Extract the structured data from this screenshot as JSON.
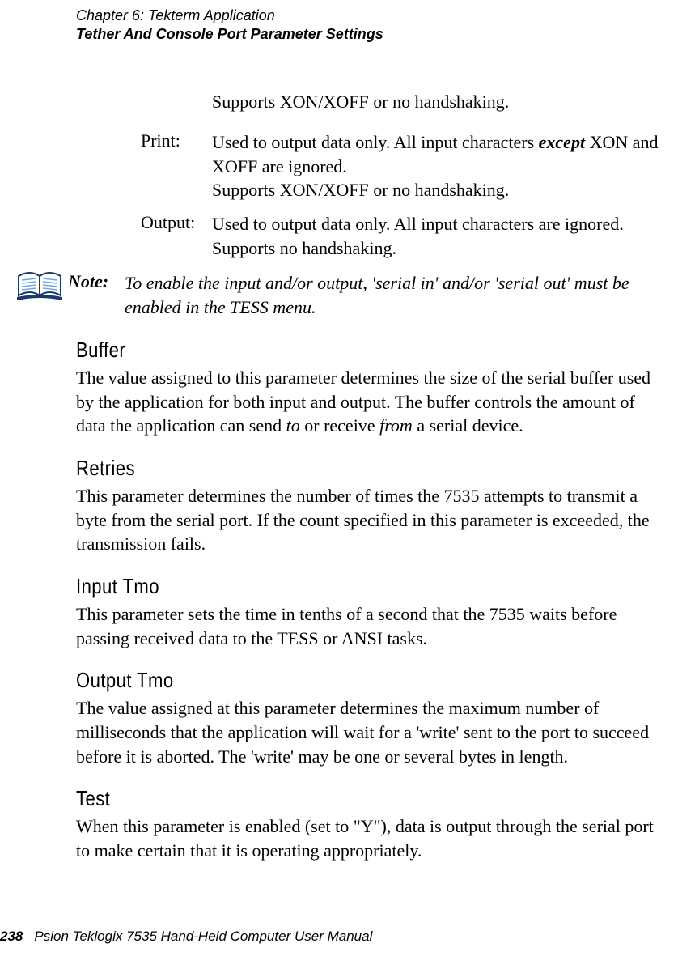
{
  "header": {
    "chapter": "Chapter 6: Tekterm Application",
    "section": "Tether And Console Port Parameter Settings"
  },
  "prelude": "Supports XON/XOFF or no handshaking.",
  "defs": {
    "print": {
      "label": "Print:",
      "l1a": "Used to output data only. All input characters ",
      "except": "except",
      "l1b": " XON and XOFF are ignored.",
      "l2": "Supports XON/XOFF or no handshaking."
    },
    "output": {
      "label": "Output:",
      "l1": "Used to output data only. All input characters are ignored.",
      "l2": "Supports no handshaking."
    }
  },
  "note": {
    "label": "Note:",
    "text": "To enable the input and/or output, 'serial in' and/or 'serial out' must be enabled in the TESS menu."
  },
  "sections": {
    "buffer": {
      "h": "Buffer",
      "p1a": "The value assigned to this parameter determines the size of the serial buffer used by the application for both input and output. The buffer controls the amount of data the application can send ",
      "to": "to",
      "p1b": " or receive ",
      "from": "from",
      "p1c": " a serial device."
    },
    "retries": {
      "h": "Retries",
      "p": "This parameter determines the number of times the 7535 attempts to transmit a byte from the serial port. If the count specified in this parameter is exceeded, the transmission fails."
    },
    "input_tmo": {
      "h": "Input Tmo",
      "p": "This parameter sets the time in tenths of a second that the 7535 waits before passing received data to the TESS or ANSI tasks."
    },
    "output_tmo": {
      "h": "Output Tmo",
      "p": "The value assigned at this parameter determines the maximum number of milliseconds that the application will wait for a 'write' sent to the port to succeed before it is aborted. The 'write' may be one or several bytes in length."
    },
    "test": {
      "h": "Test",
      "p": "When this parameter is enabled (set to \"Y\"), data is output through the serial port to make certain that it is operating appropriately."
    }
  },
  "footer": {
    "page": "238",
    "title": "Psion Teklogix 7535 Hand-Held Computer User Manual"
  }
}
